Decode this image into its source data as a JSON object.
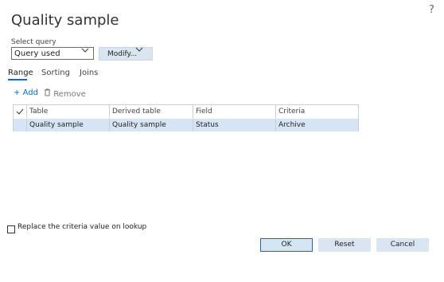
{
  "dialog": {
    "title": "Quality sample",
    "help": "?"
  },
  "query": {
    "label": "Select query",
    "selected": "Query used",
    "modify_label": "Modify..."
  },
  "tabs": [
    {
      "label": "Range",
      "active": true
    },
    {
      "label": "Sorting",
      "active": false
    },
    {
      "label": "Joins",
      "active": false
    }
  ],
  "toolbar": {
    "add_label": "Add",
    "remove_label": "Remove"
  },
  "grid": {
    "columns": [
      "Table",
      "Derived table",
      "Field",
      "Criteria"
    ],
    "rows": [
      {
        "table": "Quality sample",
        "derived_table": "Quality sample",
        "field": "Status",
        "criteria": "Archive"
      }
    ]
  },
  "options": {
    "replace_criteria_label": "Replace the criteria value on lookup",
    "replace_criteria_checked": false
  },
  "footer": {
    "ok": "OK",
    "reset": "Reset",
    "cancel": "Cancel"
  },
  "colors": {
    "accent": "#0b6bcb",
    "selection": "#d6e5f5",
    "button_bg": "#d9e6f2"
  }
}
